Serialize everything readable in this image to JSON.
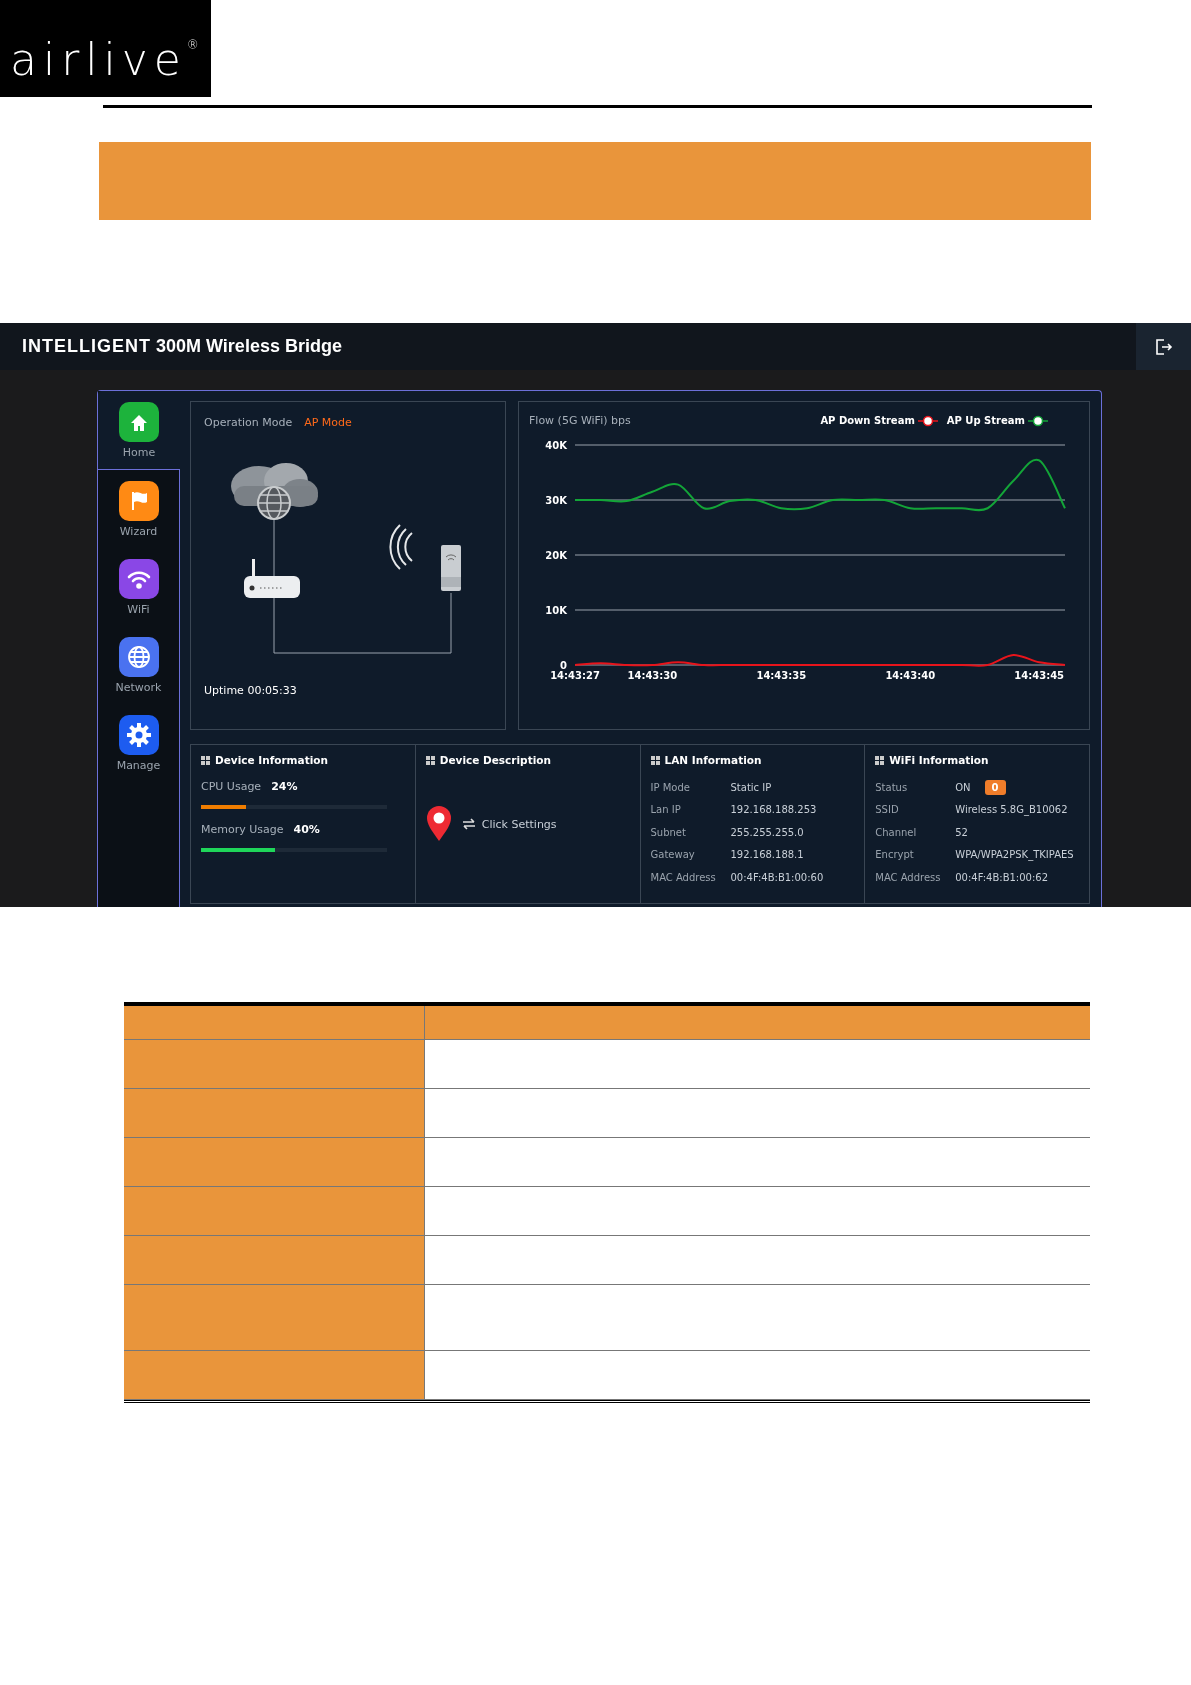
{
  "logo": {
    "text": "airlive",
    "mark": "®"
  },
  "app": {
    "title_bold": "INTELLIGENT",
    "title": "300M Wireless Bridge",
    "sidebar": [
      {
        "label": "Home",
        "kind": "home",
        "selected": true
      },
      {
        "label": "Wizard",
        "kind": "wizard",
        "selected": false
      },
      {
        "label": "WiFi",
        "kind": "wifi",
        "selected": false
      },
      {
        "label": "Network",
        "kind": "network",
        "selected": false
      },
      {
        "label": "Manage",
        "kind": "manage",
        "selected": false
      }
    ],
    "operation": {
      "label": "Operation Mode",
      "value": "AP Mode",
      "uptime": "Uptime 00:05:33"
    },
    "flow": {
      "title": "Flow (5G WiFi) bps",
      "chart_data": {
        "type": "line",
        "categories": [
          "14:43:27",
          null,
          null,
          "14:43:30",
          null,
          null,
          null,
          null,
          "14:43:35",
          null,
          null,
          null,
          null,
          "14:43:40",
          null,
          null,
          null,
          null,
          "14:43:45",
          null
        ],
        "series": [
          {
            "name": "AP Down Stream",
            "color": "#e8141b",
            "values": [
              0,
              300,
              0,
              0,
              500,
              0,
              0,
              0,
              0,
              0,
              0,
              0,
              0,
              0,
              0,
              0,
              0,
              1800,
              500,
              0
            ]
          },
          {
            "name": "AP Up Stream",
            "color": "#13a538",
            "values": [
              30000,
              30000,
              29800,
              31500,
              32800,
              28500,
              29800,
              30000,
              28500,
              28500,
              30000,
              30000,
              30000,
              28500,
              28500,
              28500,
              28500,
              33500,
              37200,
              28500
            ]
          }
        ],
        "ylim": [
          0,
          40000
        ],
        "grid": true,
        "yticks": [
          {
            "value": 0,
            "label": "0"
          },
          {
            "value": 10000,
            "label": "10K"
          },
          {
            "value": 20000,
            "label": "20K"
          },
          {
            "value": 30000,
            "label": "30K"
          },
          {
            "value": 40000,
            "label": "40K"
          }
        ]
      }
    },
    "device_info": {
      "title": "Device Information",
      "meters": [
        {
          "label": "CPU Usage",
          "reading": "24%",
          "level": 0.24,
          "color": "#f07d00"
        },
        {
          "label": "Memory Usage",
          "reading": "40%",
          "level": 0.4,
          "color": "#1fd65a"
        }
      ]
    },
    "device_description": {
      "title": "Device Description",
      "link": "Click Settings"
    },
    "lan": {
      "title": "LAN Information",
      "rows": [
        {
          "label": "IP Mode",
          "value": "Static IP"
        },
        {
          "label": "Lan IP",
          "value": "192.168.188.253"
        },
        {
          "label": "Subnet",
          "value": "255.255.255.0"
        },
        {
          "label": "Gateway",
          "value": "192.168.188.1"
        },
        {
          "label": "MAC Address",
          "value": "00:4F:4B:B1:00:60"
        }
      ]
    },
    "wifi": {
      "title": "WiFi Information",
      "rows": [
        {
          "label": "Status",
          "value": "ON",
          "badge": "0"
        },
        {
          "label": "SSID",
          "value": "Wireless 5.8G_B10062"
        },
        {
          "label": "Channel",
          "value": "52"
        },
        {
          "label": "Encrypt",
          "value": "WPA/WPA2PSK_TKIPAES"
        },
        {
          "label": "MAC Address",
          "value": "00:4F:4B:B1:00:62"
        }
      ]
    }
  }
}
